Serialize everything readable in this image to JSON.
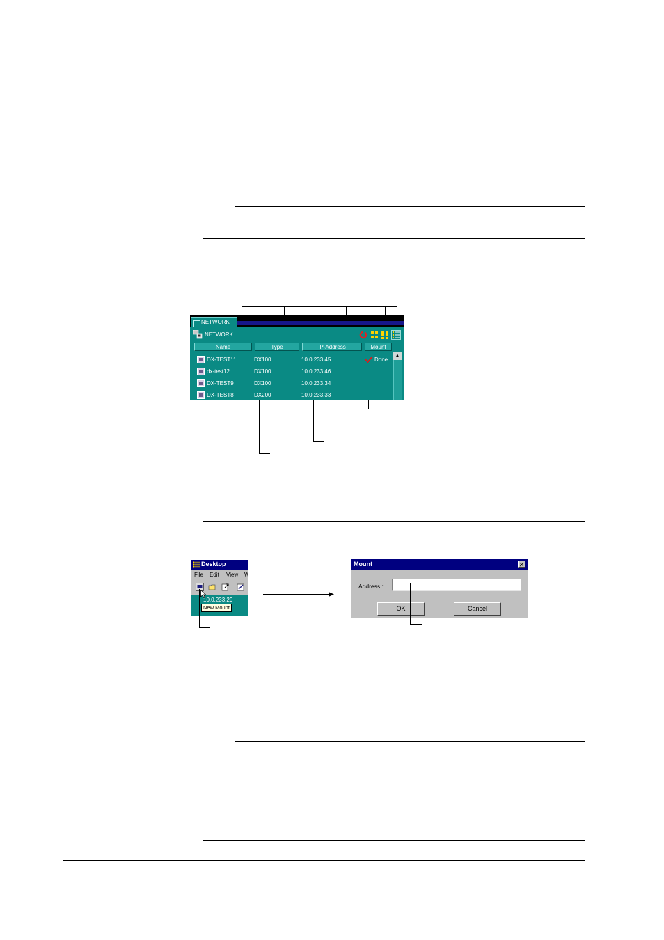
{
  "network_window": {
    "tab_label": "NETWORK",
    "tree_label": "NETWORK",
    "columns": [
      "Name",
      "Type",
      "IP-Address",
      "Mount"
    ],
    "rows": [
      {
        "name": "DX-TEST11",
        "type": "DX100",
        "ip": "10.0.233.45",
        "mount": "Done"
      },
      {
        "name": "dx-test12",
        "type": "DX100",
        "ip": "10.0.233.46",
        "mount": ""
      },
      {
        "name": "DX-TEST9",
        "type": "DX100",
        "ip": "10.0.233.34",
        "mount": ""
      },
      {
        "name": "DX-TEST8",
        "type": "DX200",
        "ip": "10.0.233.33",
        "mount": ""
      }
    ],
    "scroll_up_glyph": "▲",
    "colors": {
      "background": "#0a8a84",
      "header": "#23a6a0",
      "title_bar": "#16168a",
      "check": "#e01818"
    }
  },
  "desktop_window": {
    "title": "Desktop",
    "menu": [
      "File",
      "Edit",
      "View",
      "W"
    ],
    "address": "10.0.233.29",
    "tooltip": "New Mount"
  },
  "mount_dialog": {
    "title": "Mount",
    "close_glyph": "✕",
    "address_label": "Address :",
    "address_value": "",
    "ok_label": "OK",
    "cancel_label": "Cancel"
  }
}
